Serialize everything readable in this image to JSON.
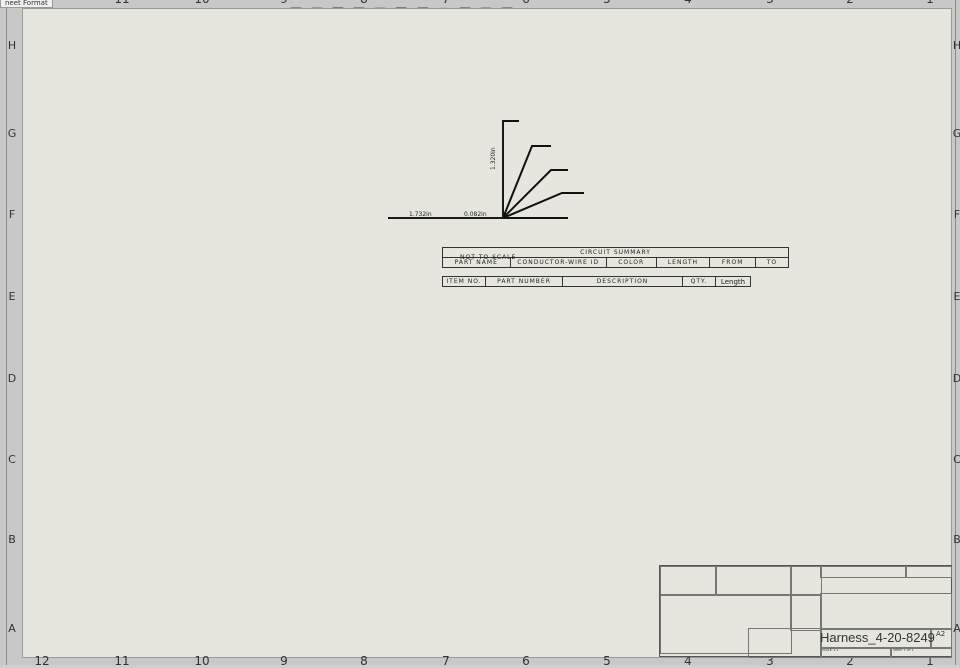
{
  "app": {
    "tab_label": "neet Format"
  },
  "border": {
    "rows": [
      "H",
      "G",
      "F",
      "E",
      "D",
      "C",
      "B",
      "A"
    ],
    "cols_top": [
      "11",
      "10",
      "9",
      "8",
      "7",
      "6",
      "5",
      "4",
      "3",
      "2",
      "1"
    ],
    "cols_bottom": [
      "12",
      "11",
      "10",
      "9",
      "8",
      "7",
      "6",
      "5",
      "4",
      "3",
      "2",
      "1"
    ]
  },
  "drawing": {
    "dim_vertical": "1.320in",
    "dim_horizontal_1": "1.732in",
    "dim_horizontal_2": "0.082in",
    "note": "NOT TO SCALE"
  },
  "circuit_summary": {
    "title": "CIRCUIT SUMMARY",
    "headers": [
      "PART NAME",
      "CONDUCTOR-WIRE ID",
      "COLOR",
      "LENGTH",
      "FROM",
      "TO"
    ]
  },
  "bom": {
    "headers": [
      "ITEM NO.",
      "PART NUMBER",
      "DESCRIPTION",
      "QTY.",
      "Length"
    ]
  },
  "title_block": {
    "drawing_number": "Harness_4-20-8249",
    "size": "A2",
    "scale": "SCALE: 1:1",
    "sheet": "SHEET 1 OF 1"
  },
  "colors": {
    "sheet": "#e6e6df",
    "frame": "#c8c8c8",
    "line": "#111111"
  }
}
